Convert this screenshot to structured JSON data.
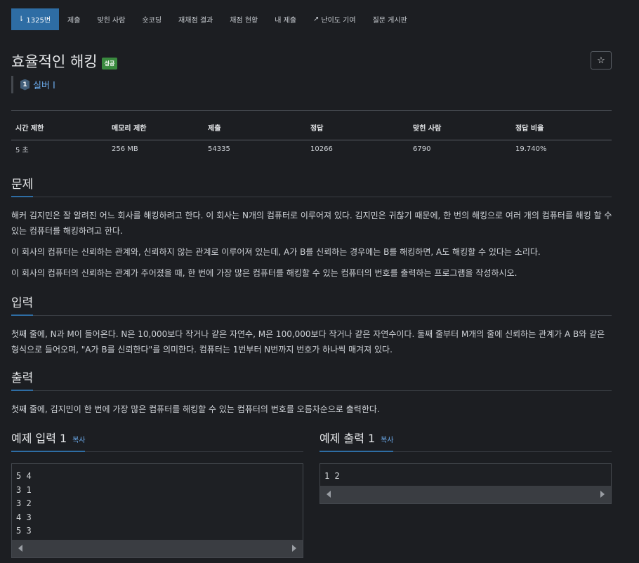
{
  "nav": {
    "tabs": [
      {
        "label": "1325번",
        "icon": "tier-1-icon"
      },
      {
        "label": "제출"
      },
      {
        "label": "맞힌 사람"
      },
      {
        "label": "숏코딩"
      },
      {
        "label": "재채점 결과"
      },
      {
        "label": "채점 현황"
      },
      {
        "label": "내 제출"
      },
      {
        "label": "난이도 기여",
        "icon": "external-link-icon"
      },
      {
        "label": "질문 게시판"
      }
    ]
  },
  "problem": {
    "title": "효율적인 해킹",
    "badge": "성공",
    "tier_level": "1",
    "tier_label": "실버 I",
    "star": "☆"
  },
  "info": {
    "headers": [
      "시간 제한",
      "메모리 제한",
      "제출",
      "정답",
      "맞힌 사람",
      "정답 비율"
    ],
    "values": [
      "5 초",
      "256 MB",
      "54335",
      "10266",
      "6790",
      "19.740%"
    ]
  },
  "sections": {
    "problem_h": "문제",
    "problem_p1": "해커 김지민은 잘 알려진 어느 회사를 해킹하려고 한다. 이 회사는 N개의 컴퓨터로 이루어져 있다. 김지민은 귀찮기 때문에, 한 번의 해킹으로 여러 개의 컴퓨터를 해킹 할 수 있는 컴퓨터를 해킹하려고 한다.",
    "problem_p2": "이 회사의 컴퓨터는 신뢰하는 관계와, 신뢰하지 않는 관계로 이루어져 있는데, A가 B를 신뢰하는 경우에는 B를 해킹하면, A도 해킹할 수 있다는 소리다.",
    "problem_p3": "이 회사의 컴퓨터의 신뢰하는 관계가 주어졌을 때, 한 번에 가장 많은 컴퓨터를 해킹할 수 있는 컴퓨터의 번호를 출력하는 프로그램을 작성하시오.",
    "input_h": "입력",
    "input_p": "첫째 줄에, N과 M이 들어온다. N은 10,000보다 작거나 같은 자연수, M은 100,000보다 작거나 같은 자연수이다. 둘째 줄부터 M개의 줄에 신뢰하는 관계가 A B와 같은 형식으로 들어오며, \"A가 B를 신뢰한다\"를 의미한다. 컴퓨터는 1번부터 N번까지 번호가 하나씩 매겨져 있다.",
    "output_h": "출력",
    "output_p": "첫째 줄에, 김지민이 한 번에 가장 많은 컴퓨터를 해킹할 수 있는 컴퓨터의 번호를 오름차순으로 출력한다."
  },
  "examples": {
    "input_label": "예제 입력 1",
    "output_label": "예제 출력 1",
    "copy_label": "복사",
    "input_code": "5 4\n3 1\n3 2\n4 3\n5 3",
    "output_code": "1 2"
  },
  "colors": {
    "accent": "#2e6da4",
    "success": "#3a8a3f",
    "link": "#6aa9e9"
  }
}
